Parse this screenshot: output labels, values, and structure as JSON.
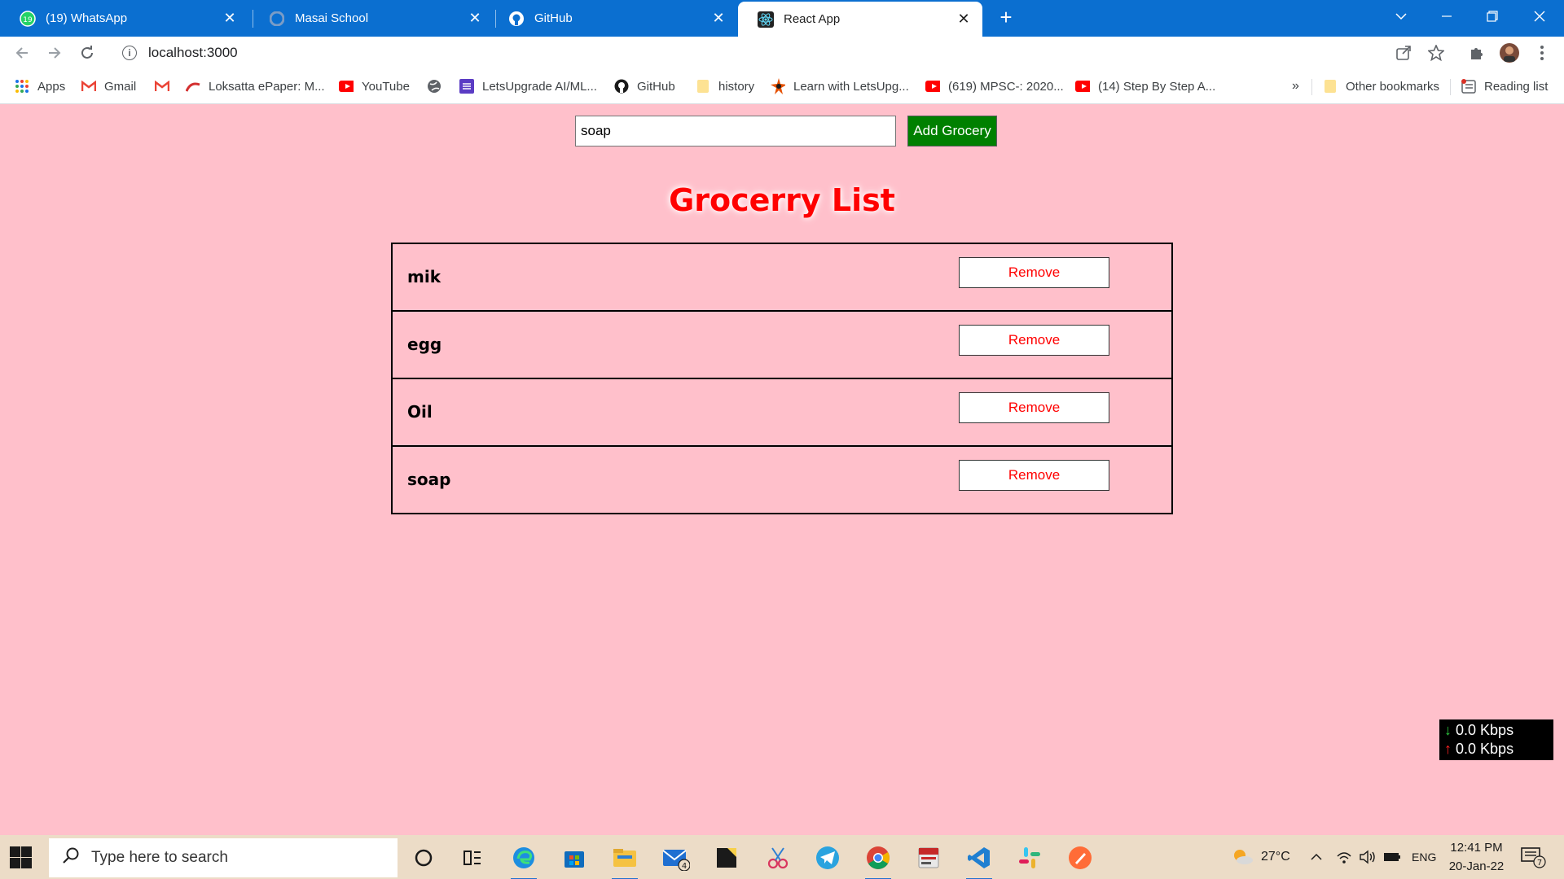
{
  "browser": {
    "tabs": [
      {
        "title": "(19) WhatsApp",
        "icon": "whatsapp-icon",
        "active": false
      },
      {
        "title": "Masai School",
        "icon": "masai-icon",
        "active": false
      },
      {
        "title": "GitHub",
        "icon": "github-icon",
        "active": false
      },
      {
        "title": "React App",
        "icon": "react-icon",
        "active": true
      }
    ],
    "tab_close_glyph": "✕",
    "url": "localhost:3000",
    "bookmarks": [
      {
        "label": "Apps",
        "icon": "apps-grid-icon"
      },
      {
        "label": "Gmail",
        "icon": "gmail-icon"
      },
      {
        "label": "",
        "icon": "gmail-icon"
      },
      {
        "label": "Loksatta ePaper: M...",
        "icon": "loksatta-icon"
      },
      {
        "label": "YouTube",
        "icon": "youtube-icon"
      },
      {
        "label": "",
        "icon": "globe-icon"
      },
      {
        "label": "LetsUpgrade AI/ML...",
        "icon": "letsupgrade-icon"
      },
      {
        "label": "GitHub",
        "icon": "github-icon"
      },
      {
        "label": "history",
        "icon": "folder-icon"
      },
      {
        "label": "Learn with LetsUpg...",
        "icon": "letsupgrade-star-icon"
      },
      {
        "label": "(619) MPSC-: 2020...",
        "icon": "youtube-icon"
      },
      {
        "label": "(14) Step By Step A...",
        "icon": "youtube-icon"
      }
    ],
    "more_bookmarks": "»",
    "other_bookmarks": "Other bookmarks",
    "reading_list": "Reading list"
  },
  "app": {
    "input_value": "soap",
    "add_button_label": "Add Grocery",
    "title": "Grocerry List",
    "items": [
      {
        "name": "mik",
        "remove_label": "Remove"
      },
      {
        "name": "egg",
        "remove_label": "Remove"
      },
      {
        "name": "Oil",
        "remove_label": "Remove"
      },
      {
        "name": "soap",
        "remove_label": "Remove"
      }
    ],
    "colors": {
      "background": "#ffc0cb",
      "title": "#ff0000",
      "add_button": "#008000",
      "remove_text": "#ff0000"
    }
  },
  "netmeter": {
    "down": "0.0 Kbps",
    "up": "0.0 Kbps"
  },
  "taskbar": {
    "search_placeholder": "Type here to search",
    "mail_badge": "4",
    "weather": "27°C",
    "language": "ENG",
    "time": "12:41 PM",
    "date": "20-Jan-22",
    "notification_count": "7"
  }
}
